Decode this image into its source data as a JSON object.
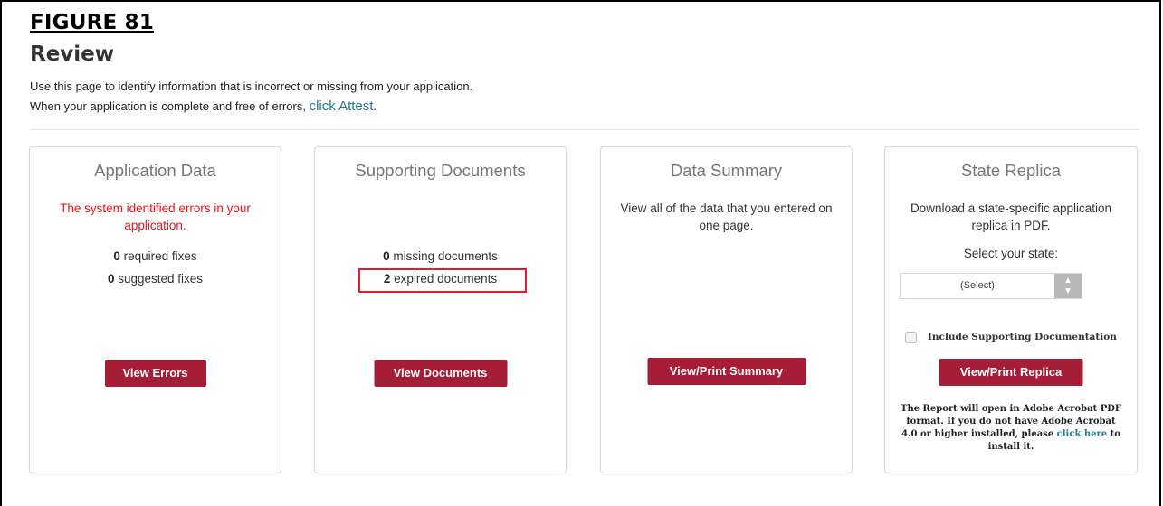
{
  "figure_label": "FIGURE 81",
  "page": {
    "title": "Review",
    "intro_line1": "Use this page to identify information that is incorrect or missing from your application.",
    "intro_line2_prefix": "When your application is complete and free of errors,",
    "intro_line2_link": "click Attest",
    "intro_line2_suffix": "."
  },
  "cards": {
    "application_data": {
      "title": "Application Data",
      "error_message": "The system identified errors in your application.",
      "required_count": "0",
      "required_label": "required fixes",
      "suggested_count": "0",
      "suggested_label": "suggested fixes",
      "button": "View Errors"
    },
    "supporting_documents": {
      "title": "Supporting Documents",
      "missing_count": "0",
      "missing_label": "missing documents",
      "expired_count": "2",
      "expired_label": "expired documents",
      "button": "View Documents"
    },
    "data_summary": {
      "title": "Data Summary",
      "description": "View all of the data that you entered on one page.",
      "button": "View/Print Summary"
    },
    "state_replica": {
      "title": "State Replica",
      "description": "Download a state-specific application replica in PDF.",
      "select_label": "Select your state:",
      "select_value": "(Select)",
      "checkbox_label": "Include Supporting Documentation",
      "checkbox_checked": false,
      "button": "View/Print Replica",
      "note_text": "The Report will open in Adobe Acrobat PDF format. If you do not have Adobe Acrobat 4.0 or higher installed, please",
      "note_link": "click here",
      "note_suffix": "to install it."
    }
  },
  "colors": {
    "button_bg": "#a51d36",
    "error_text": "#e8141d",
    "link": "#1f7a8c",
    "highlight_box": "#e21f26"
  }
}
